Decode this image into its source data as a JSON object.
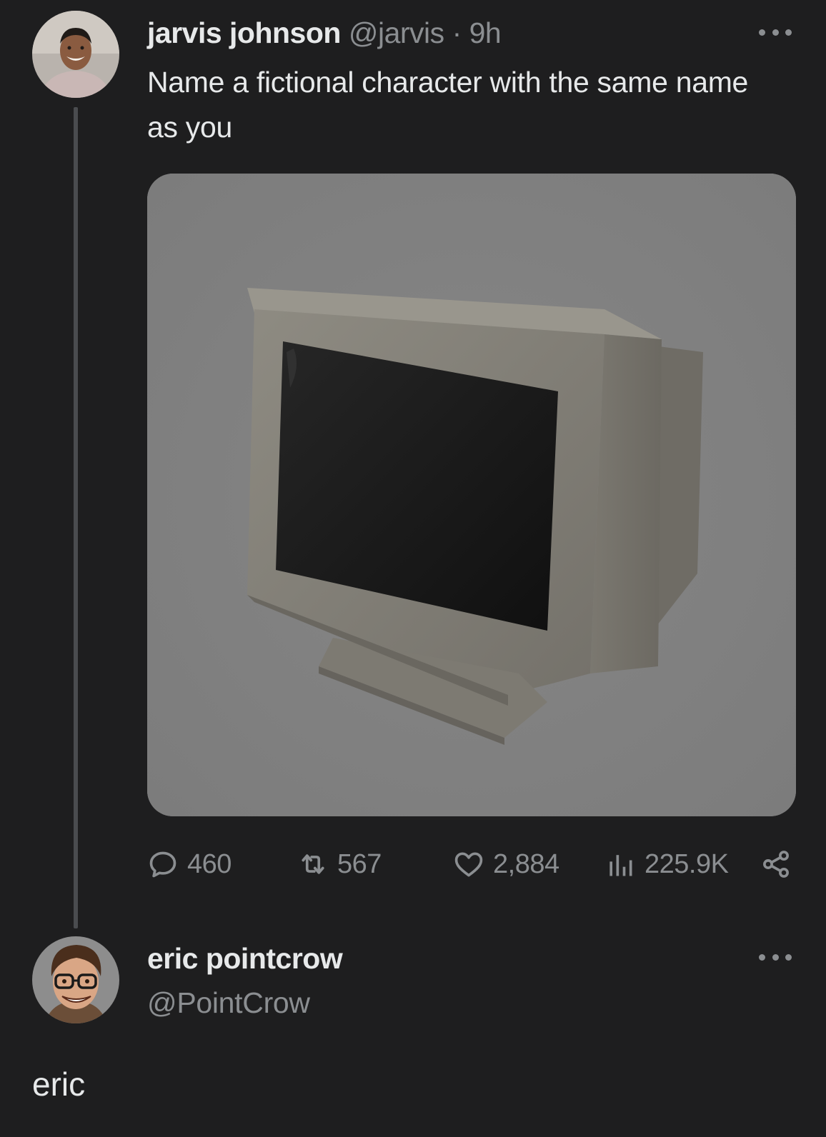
{
  "tweet": {
    "author": {
      "display_name": "jarvis johnson",
      "handle": "@jarvis",
      "separator": "·",
      "time": "9h"
    },
    "text": "Name a fictional character with the same name as you",
    "media": {
      "description_icon": "crt-monitor-image"
    },
    "stats": {
      "replies": "460",
      "retweets": "567",
      "likes": "2,884",
      "views": "225.9K"
    },
    "icons": {
      "reply": "reply-icon",
      "retweet": "retweet-icon",
      "like": "heart-icon",
      "views": "views-icon",
      "share": "share-icon",
      "more": "more-icon"
    }
  },
  "reply": {
    "author": {
      "display_name": "eric pointcrow",
      "handle": "@PointCrow"
    },
    "text": "eric"
  },
  "colors": {
    "background": "#1e1e1f",
    "primary_text": "#e7e9ea",
    "secondary_text": "#8b8e91",
    "thread_line": "#4a4c4f"
  }
}
